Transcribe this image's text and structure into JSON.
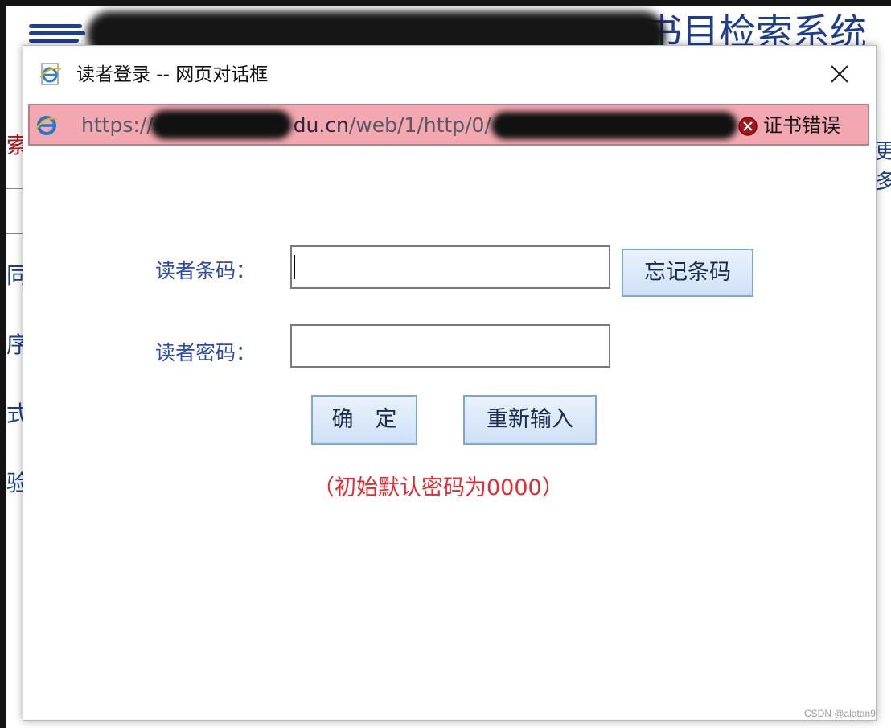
{
  "background": {
    "title": "书目检索系统",
    "side_chars": [
      "索",
      "同",
      "序",
      "式",
      "验"
    ],
    "right_chars": "更多"
  },
  "dialog": {
    "title": "读者登录 -- 网页对话框",
    "close_icon": "close-x-icon",
    "address": {
      "url_prefix": "https://",
      "url_domain": "du.cn",
      "url_path": "/web/1/http/0/",
      "cert_error": "证书错误"
    },
    "form": {
      "barcode_label": "读者条码：",
      "barcode_value": "",
      "forgot_button": "忘记条码",
      "password_label": "读者密码：",
      "password_value": "",
      "confirm_button": "确　定",
      "reset_button": "重新输入",
      "hint": "（初始默认密码为0000）"
    }
  },
  "watermark": "CSDN @alatan9",
  "colors": {
    "label_blue": "#2a4bb0",
    "hint_red": "#e8282e",
    "address_error_pink": "#f3a7b0",
    "button_border": "#7da7d9"
  }
}
